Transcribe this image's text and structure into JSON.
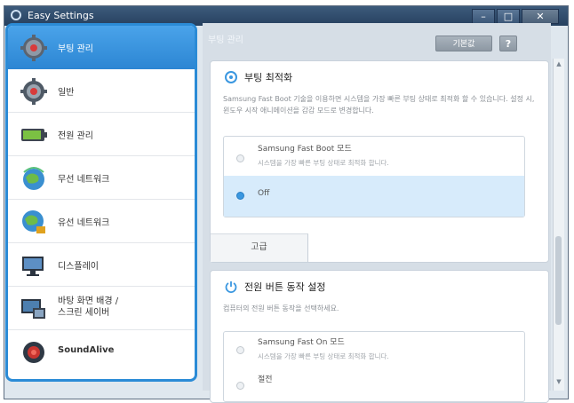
{
  "window": {
    "title": "Easy Settings",
    "min": "–",
    "max": "□",
    "close": "✕"
  },
  "sidebar": {
    "items": [
      {
        "label": "부팅 관리",
        "icon": "boot-gear-icon",
        "active": true
      },
      {
        "label": "일반",
        "icon": "general-gear-icon"
      },
      {
        "label": "전원 관리",
        "icon": "battery-icon"
      },
      {
        "label": "무선 네트워크",
        "icon": "wireless-globe-icon"
      },
      {
        "label": "유선 네트워크",
        "icon": "wired-globe-icon"
      },
      {
        "label": "디스플레이",
        "icon": "display-icon"
      },
      {
        "label": "바탕 화면 배경 / 스크린 세이버",
        "label_line1": "바탕 화면 배경 /",
        "label_line2": "스크린 세이버",
        "icon": "wallpaper-icon"
      },
      {
        "label": "SoundAlive",
        "icon": "soundalive-icon"
      }
    ]
  },
  "main": {
    "title": "부팅 관리",
    "default_button": "기본값",
    "help_button": "?",
    "boot_panel": {
      "heading": "부팅 최적화",
      "description": "Samsung Fast Boot 기술을 이용하면 시스템을 가장 빠른 부팅 상태로 최적화 할 수 있습니다. 설정 시, 윈도우 시작 애니메이션을 감감 모드로 변경합니다.",
      "options": [
        {
          "title": "Samsung Fast Boot 모드",
          "subtitle": "시스템을 가장 빠른 부팅 상태로 최적화 합니다.",
          "selected": false
        },
        {
          "title": "Off",
          "subtitle": "",
          "selected": true
        }
      ],
      "advanced_tab": "고급"
    },
    "power_panel": {
      "heading": "전원 버튼 동작 설정",
      "description": "컴퓨터의 전원 버튼 동작을 선택하세요.",
      "options": [
        {
          "title": "Samsung Fast On 모드",
          "subtitle": "시스템을 가장 빠른 부팅 상태로 최적화 합니다.",
          "selected": false
        },
        {
          "title": "절전",
          "subtitle": "",
          "selected": false
        }
      ]
    }
  },
  "colors": {
    "accent": "#2c86d3",
    "titlebar": "#2f4b6c",
    "selected_option": "#d7ebfb"
  }
}
